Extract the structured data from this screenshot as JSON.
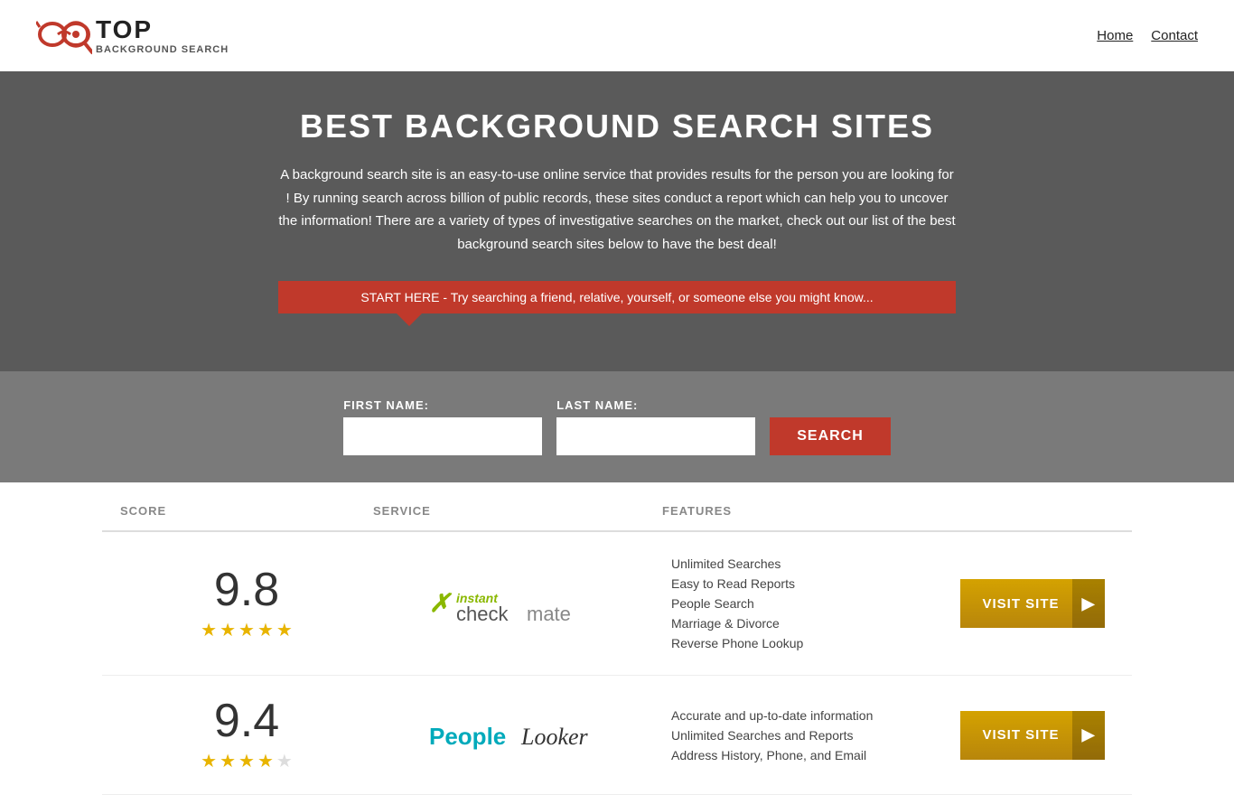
{
  "header": {
    "logo_top": "TOP",
    "logo_sub_line1": "BACKGROUND",
    "logo_sub_line2": "SEARCH",
    "nav": [
      {
        "label": "Home",
        "href": "#"
      },
      {
        "label": "Contact",
        "href": "#"
      }
    ]
  },
  "hero": {
    "title": "BEST BACKGROUND SEARCH SITES",
    "description": "A background search site is an easy-to-use online service that provides results  for the person you are looking for ! By  running  search across billion of public records, these sites conduct  a report which can help you to uncover the information! There are a variety of types of investigative searches on the market, check out our  list of the best background search sites below to have the best deal!",
    "callout": "START HERE - Try searching a friend, relative, yourself, or someone else you might know..."
  },
  "search_form": {
    "first_name_label": "FIRST NAME:",
    "last_name_label": "LAST NAME:",
    "search_button": "SEARCH",
    "first_name_placeholder": "",
    "last_name_placeholder": ""
  },
  "table": {
    "headers": {
      "score": "SCORE",
      "service": "SERVICE",
      "features": "FEATURES",
      "action": ""
    },
    "rows": [
      {
        "score": "9.8",
        "stars": 5,
        "service_name": "Instant Checkmate",
        "service_type": "checkmate",
        "features": [
          "Unlimited Searches",
          "Easy to Read Reports",
          "People Search",
          "Marriage & Divorce",
          "Reverse Phone Lookup"
        ],
        "visit_label": "VISIT SITE"
      },
      {
        "score": "9.4",
        "stars": 4,
        "service_name": "PeopleLooker",
        "service_type": "peoplelooker",
        "features": [
          "Accurate and up-to-date information",
          "Unlimited Searches and Reports",
          "Address History, Phone, and Email"
        ],
        "visit_label": "VISIT SITE"
      }
    ]
  }
}
